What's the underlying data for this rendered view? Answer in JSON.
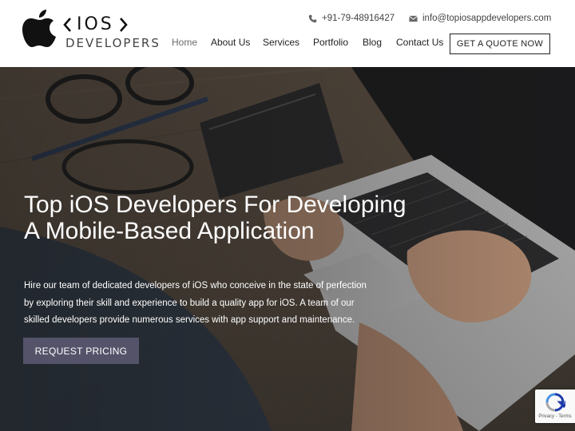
{
  "brand": {
    "logo_bracket_left": "<",
    "logo_main": "IOS",
    "logo_bracket_right": ">",
    "logo_sub": "DEVELOPERS"
  },
  "contact": {
    "phone": "+91-79-48916427",
    "email": "info@topiosappdevelopers.com",
    "phone_icon": "phone-icon",
    "email_icon": "envelope-icon"
  },
  "nav": {
    "items": [
      {
        "label": "Home",
        "active": true
      },
      {
        "label": "About Us"
      },
      {
        "label": "Services"
      },
      {
        "label": "Portfolio"
      },
      {
        "label": "Blog"
      },
      {
        "label": "Contact Us"
      }
    ],
    "cta_label": "GET A QUOTE NOW"
  },
  "hero": {
    "title": "Top iOS Developers For Developing A Mobile-Based Application",
    "description": "Hire our team of dedicated developers of iOS who conceive in the state of perfection by exploring their skill and experience to build a quality app for iOS. A team of our skilled developers provide numerous services with app support and maintenance.",
    "button_label": "REQUEST PRICING"
  },
  "recaptcha": {
    "terms": "Privacy - Terms"
  },
  "colors": {
    "header_bg": "#ffffff",
    "nav_active": "#6b6b6b",
    "hero_button": "#54536a",
    "text_dark": "#222222"
  }
}
